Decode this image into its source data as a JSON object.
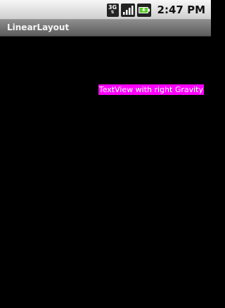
{
  "status_bar": {
    "network_type": "3G",
    "time": "2:47",
    "time_suffix": "PM",
    "icons": [
      "3g-data-icon",
      "signal-strength-icon",
      "battery-icon"
    ]
  },
  "app": {
    "title": "LinearLayout"
  },
  "content": {
    "textview_label": "TextView with right Gravity",
    "textview_background": "#ff00ff",
    "textview_color": "#ffffff"
  },
  "colors": {
    "screen_background": "#000000",
    "title_bar": "#6e6e6e",
    "status_bar": "#e0e0e0"
  }
}
